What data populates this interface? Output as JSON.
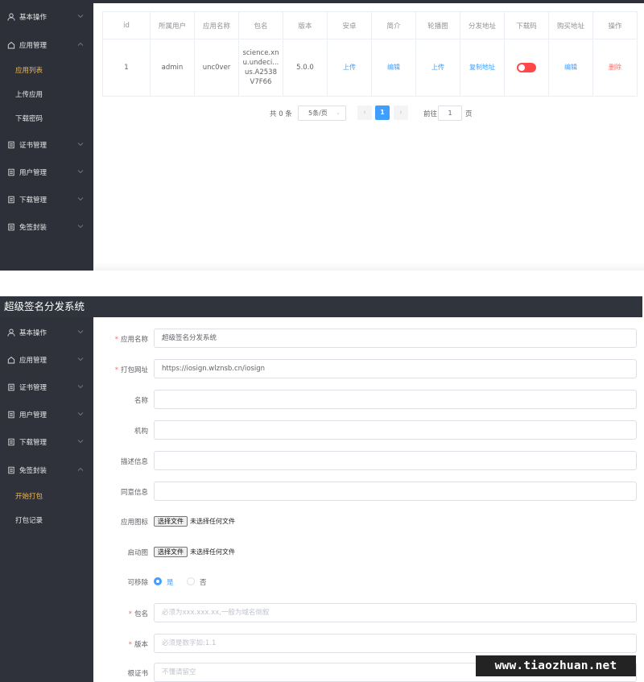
{
  "top": {
    "sidebar": {
      "items": [
        {
          "label": "基本操作",
          "icon": "user-icon"
        },
        {
          "label": "应用管理",
          "icon": "home-icon"
        },
        {
          "label": "证书管理",
          "icon": "document-icon"
        },
        {
          "label": "用户管理",
          "icon": "document-icon"
        },
        {
          "label": "下载管理",
          "icon": "document-icon"
        },
        {
          "label": "免签封装",
          "icon": "document-icon"
        }
      ],
      "subitems": [
        {
          "label": "应用列表",
          "active": true
        },
        {
          "label": "上传应用",
          "active": false
        },
        {
          "label": "下载密码",
          "active": false
        }
      ]
    },
    "table": {
      "headers": [
        "id",
        "所属用户",
        "应用名称",
        "包名",
        "版本",
        "安卓",
        "简介",
        "轮播图",
        "分发地址",
        "下载码",
        "购买地址",
        "操作"
      ],
      "row": {
        "id": "1",
        "user": "admin",
        "app_name": "unc0ver",
        "package_lines": [
          "science.xn",
          "u.undeci...",
          "us.A2538",
          "V7F66"
        ],
        "version": "5.0.0",
        "android": "上传",
        "intro": "编辑",
        "carousel": "上传",
        "dist_url": "复制地址",
        "buy_url": "编辑",
        "action": "删除"
      }
    },
    "pager": {
      "total": "共 0 条",
      "page_size": "5条/页",
      "prev": "‹",
      "current": "1",
      "next": "›",
      "goto": "前往",
      "goto_value": "1",
      "page_unit": "页"
    }
  },
  "bottom": {
    "title": "超级签名分发系统",
    "sidebar": {
      "items": [
        {
          "label": "基本操作",
          "icon": "user-icon"
        },
        {
          "label": "应用管理",
          "icon": "home-icon"
        },
        {
          "label": "证书管理",
          "icon": "document-icon"
        },
        {
          "label": "用户管理",
          "icon": "document-icon"
        },
        {
          "label": "下载管理",
          "icon": "document-icon"
        },
        {
          "label": "免签封装",
          "icon": "document-icon"
        }
      ],
      "subitems": [
        {
          "label": "开始打包",
          "active": true
        },
        {
          "label": "打包记录",
          "active": false
        }
      ]
    },
    "form": {
      "app_name": {
        "label": "应用名称",
        "value": "超级签名分发系统"
      },
      "pack_url": {
        "label": "打包网址",
        "value": "https://iosign.wlznsb.cn/iosign"
      },
      "name": {
        "label": "名称",
        "value": ""
      },
      "org": {
        "label": "机构",
        "value": ""
      },
      "desc": {
        "label": "描述信息",
        "value": ""
      },
      "consent": {
        "label": "同意信息",
        "value": ""
      },
      "app_icon": {
        "label": "应用图标",
        "button": "选择文件",
        "status": "未选择任何文件"
      },
      "splash": {
        "label": "启动图",
        "button": "选择文件",
        "status": "未选择任何文件"
      },
      "removable": {
        "label": "可移除",
        "yes": "是",
        "no": "否",
        "selected": "是"
      },
      "bundle": {
        "label": "包名",
        "placeholder": "必须为xxx.xxx.xx,一般为域名倒叙"
      },
      "version": {
        "label": "版本",
        "placeholder": "必须是数字如:1.1"
      },
      "cert": {
        "label": "根证书",
        "placeholder": "不懂请留空"
      }
    }
  },
  "watermark": "www.tiaozhuan.net",
  "colors": {
    "sidebar_bg": "#2d3039",
    "active_submenu": "#f2b950",
    "link_blue": "#409eff",
    "danger_red": "#f56c6c",
    "toggle_red": "#ff4949"
  }
}
